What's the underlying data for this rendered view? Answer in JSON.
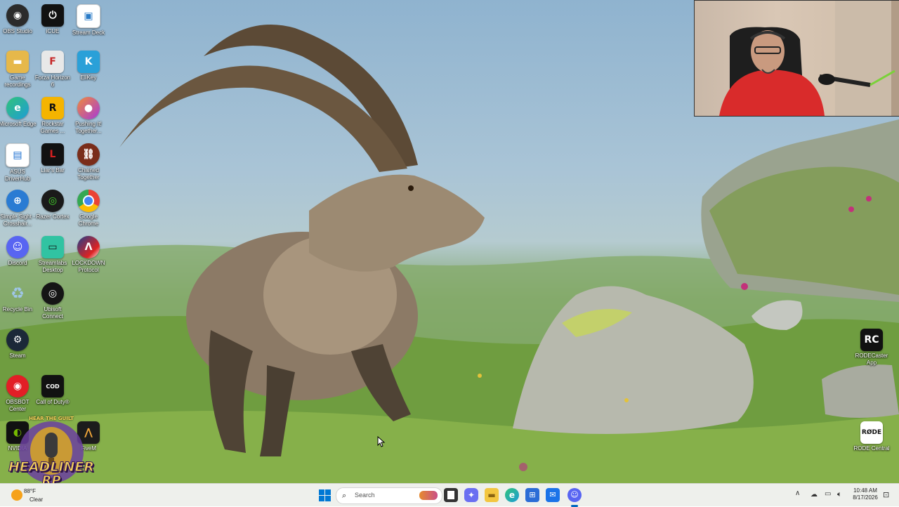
{
  "desktop_icons": [
    {
      "label": "OBS Studio",
      "icon": "obs-icon",
      "color": "#2b2b2b"
    },
    {
      "label": "iCUE",
      "icon": "icue-icon",
      "color": "#111111"
    },
    {
      "label": "Stream Deck",
      "icon": "stream-deck-icon",
      "color": "#2a7bc7"
    },
    {
      "label": "Game recordings",
      "icon": "folder-icon",
      "color": "#e6b84a"
    },
    {
      "label": "Forza Horizon 6",
      "icon": "forza-icon",
      "color": "#e8e8e8"
    },
    {
      "label": "EliKey",
      "icon": "elikey-icon",
      "color": "#2aa0d8"
    },
    {
      "label": "Microsoft Edge",
      "icon": "edge-icon",
      "color": "#1f9cd6"
    },
    {
      "label": "Rockstar Games ...",
      "icon": "rockstar-icon",
      "color": "#f5b400"
    },
    {
      "label": "Pushing It! Together...",
      "icon": "pushing-it-icon",
      "color": "#d8583a"
    },
    {
      "label": "ASUS DriverHub",
      "icon": "asus-driverhub-icon",
      "color": "#1b6fd1"
    },
    {
      "label": "Liar's Bar",
      "icon": "liars-bar-icon",
      "color": "#8a1111"
    },
    {
      "label": "Chained Together",
      "icon": "chained-together-icon",
      "color": "#7a2d1a"
    },
    {
      "label": "Simple Sight - Crosshair...",
      "icon": "crosshair-icon",
      "color": "#2a7bd3"
    },
    {
      "label": "Razer Cortex",
      "icon": "razer-cortex-icon",
      "color": "#1a1a1a"
    },
    {
      "label": "Google Chrome",
      "icon": "chrome-icon",
      "color": "#e9e9e9"
    },
    {
      "label": "Discord",
      "icon": "discord-icon",
      "color": "#5865f2"
    },
    {
      "label": "Streamlabs Desktop",
      "icon": "streamlabs-icon",
      "color": "#31c3a2"
    },
    {
      "label": "LOCKDOWN Protocol",
      "icon": "lockdown-protocol-icon",
      "color": "#203f8a"
    },
    {
      "label": "Recycle Bin",
      "icon": "recycle-bin-icon",
      "color": "#9fc6e8"
    },
    {
      "label": "Ubisoft Connect",
      "icon": "ubisoft-icon",
      "color": "#151515"
    },
    {
      "label": "Steam",
      "icon": "steam-icon",
      "color": "#1b2838"
    },
    {
      "label": "OBSBOT Center",
      "icon": "obsbot-icon",
      "color": "#e21f26"
    },
    {
      "label": "Call of Duty®",
      "icon": "call-of-duty-icon",
      "color": "#111111"
    },
    {
      "label": "NVIDIA",
      "icon": "nvidia-icon",
      "color": "#76b900"
    },
    {
      "label": "FiveM",
      "icon": "fivem-icon",
      "color": "#1c1c1c"
    },
    {
      "label": "RODECaster App",
      "icon": "rodecaster-icon",
      "color": "#111111"
    },
    {
      "label": "RODE Central",
      "icon": "rode-central-icon",
      "color": "#ffffff"
    }
  ],
  "overlay": {
    "line1": "HEAR THE GUILT",
    "line2": "HEADLINER",
    "line3": "RP"
  },
  "taskbar": {
    "weather": {
      "temp": "88°F",
      "condition": "Clear"
    },
    "search_placeholder": "Search",
    "apps": [
      {
        "icon": "file-explorer-icon",
        "color": "#f3c640"
      },
      {
        "icon": "edge-icon",
        "color": "#1f9cd6"
      },
      {
        "icon": "copilot-icon",
        "color": "#6a6ff1"
      },
      {
        "icon": "store-icon",
        "color": "#2b6cd6"
      },
      {
        "icon": "outlook-icon",
        "color": "#1a73e8"
      },
      {
        "icon": "discord-icon",
        "color": "#5865f2"
      }
    ],
    "clock": {
      "time": "10:48 AM",
      "date": "8/17/2026"
    }
  },
  "colors": {
    "taskbar_bg": "#eef0ec",
    "accent": "#0067c0"
  }
}
